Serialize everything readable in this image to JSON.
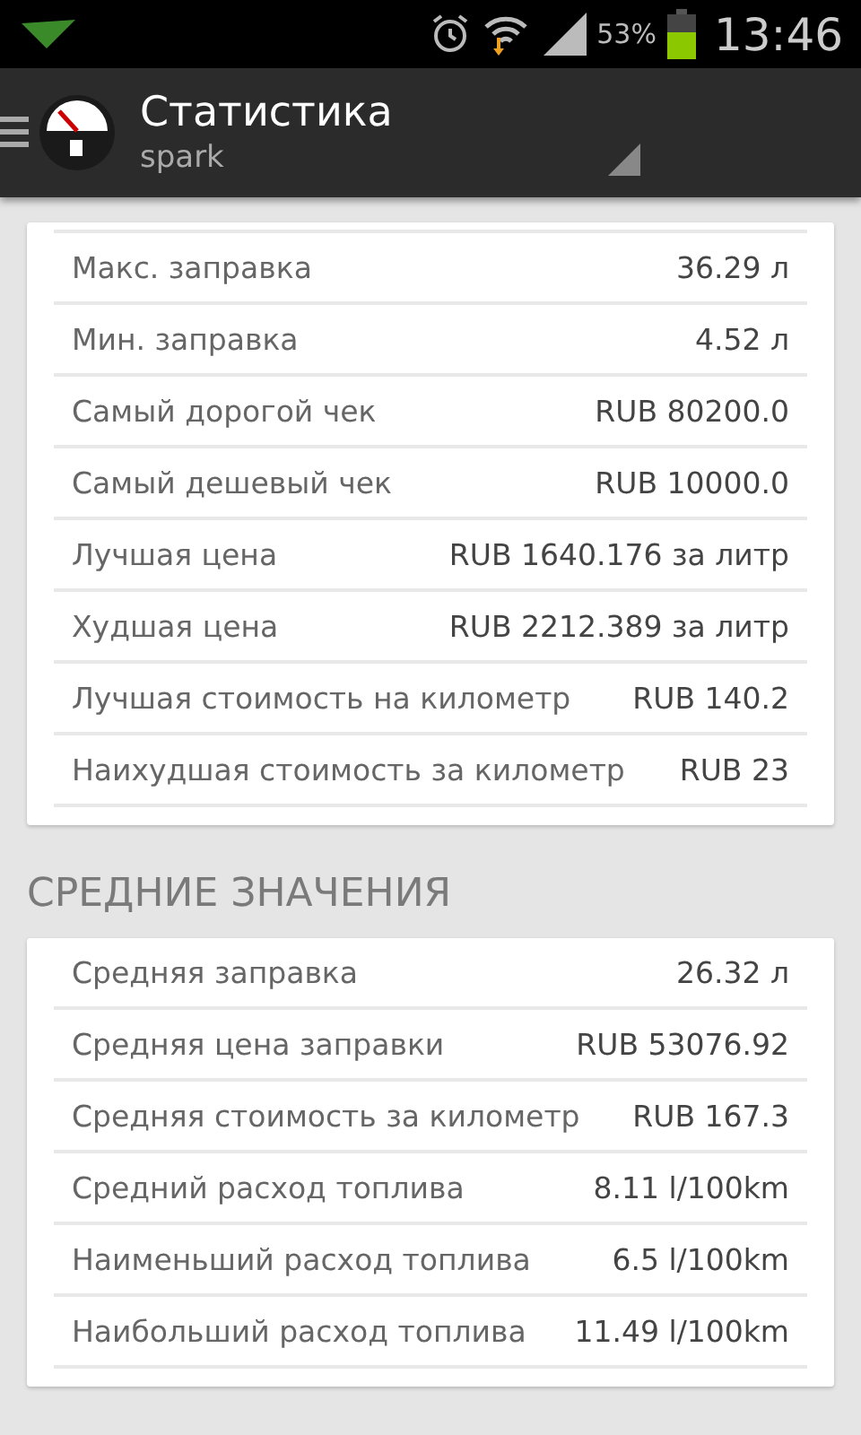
{
  "status_bar": {
    "battery": "53%",
    "time": "13:46"
  },
  "action_bar": {
    "title": "Статистика",
    "subtitle": "spark"
  },
  "sections": [
    {
      "rows": [
        {
          "label": "Макс. заправка",
          "value": "36.29 л"
        },
        {
          "label": "Мин. заправка",
          "value": "4.52 л"
        },
        {
          "label": "Самый дорогой чек",
          "value": "RUB 80200.0"
        },
        {
          "label": "Самый дешевый чек",
          "value": "RUB 10000.0"
        },
        {
          "label": "Лучшая цена",
          "value": "RUB 1640.176 за литр"
        },
        {
          "label": "Худшая цена",
          "value": "RUB 2212.389 за литр"
        },
        {
          "label": "Лучшая стоимость на километр",
          "value": "RUB 140.2"
        },
        {
          "label": "Наихудшая стоимость за километр",
          "value": "RUB 23"
        }
      ]
    },
    {
      "title": "СРЕДНИЕ ЗНАЧЕНИЯ",
      "rows": [
        {
          "label": "Средняя заправка",
          "value": "26.32 л"
        },
        {
          "label": "Средняя цена заправки",
          "value": "RUB 53076.92"
        },
        {
          "label": "Средняя стоимость за километр",
          "value": "RUB 167.3"
        },
        {
          "label": "Средний расход топлива",
          "value": "8.11 l/100km"
        },
        {
          "label": "Наименьший расход топлива",
          "value": "6.5 l/100km"
        },
        {
          "label": "Наибольший расход топлива",
          "value": "11.49 l/100km"
        }
      ]
    }
  ]
}
